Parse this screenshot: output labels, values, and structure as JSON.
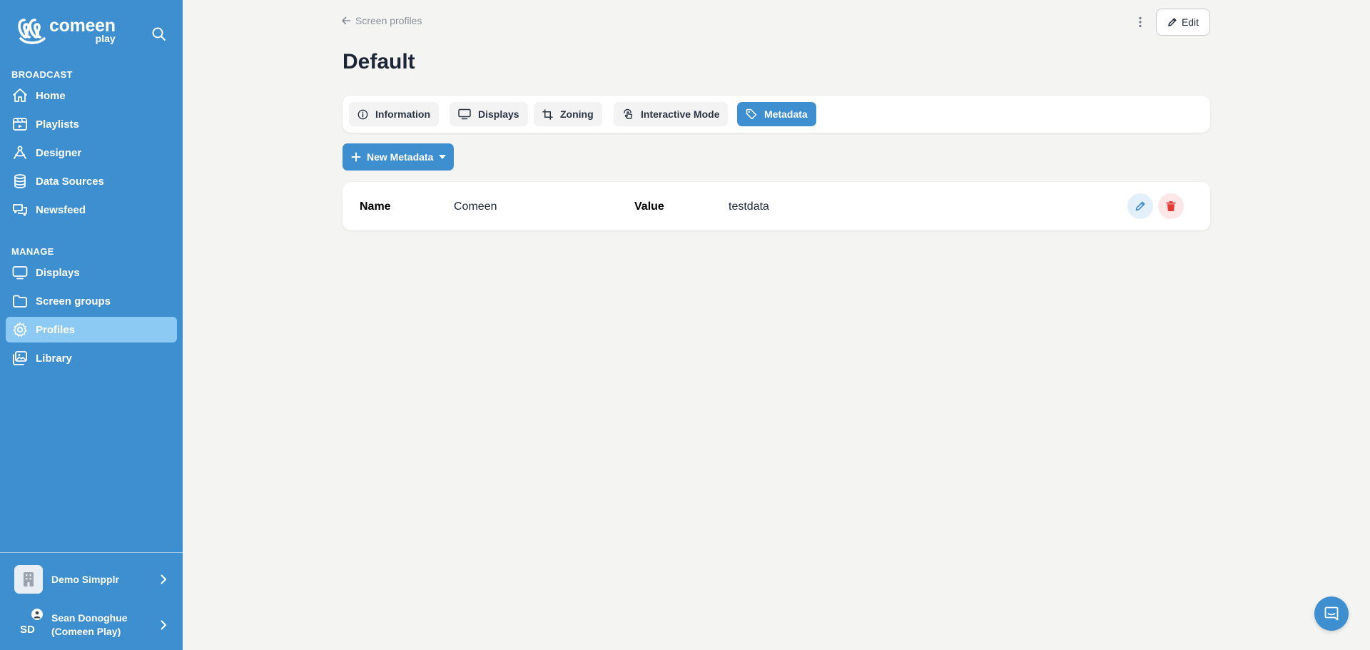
{
  "brand": {
    "name": "comeen",
    "product": "play"
  },
  "sidebar": {
    "broadcast_label": "BROADCAST",
    "manage_label": "MANAGE",
    "broadcast_items": [
      {
        "label": "Home",
        "icon": "home-icon"
      },
      {
        "label": "Playlists",
        "icon": "playlists-icon"
      },
      {
        "label": "Designer",
        "icon": "designer-icon"
      },
      {
        "label": "Data Sources",
        "icon": "database-icon"
      },
      {
        "label": "Newsfeed",
        "icon": "newsfeed-icon"
      }
    ],
    "manage_items": [
      {
        "label": "Displays",
        "icon": "monitor-icon"
      },
      {
        "label": "Screen groups",
        "icon": "folder-icon"
      },
      {
        "label": "Profiles",
        "icon": "gear-icon",
        "active": true
      },
      {
        "label": "Library",
        "icon": "library-icon"
      }
    ],
    "organization": "Demo Simpplr",
    "user": {
      "initials": "SD",
      "name_line1": "Sean Donoghue",
      "name_line2": "(Comeen Play)"
    }
  },
  "header": {
    "breadcrumb": "Screen profiles",
    "edit_label": "Edit",
    "title": "Default"
  },
  "tabs": [
    {
      "label": "Information",
      "icon": "info-icon"
    },
    {
      "label": "Displays",
      "icon": "monitor-icon"
    },
    {
      "label": "Zoning",
      "icon": "crop-icon"
    },
    {
      "label": "Interactive Mode",
      "icon": "touch-icon"
    },
    {
      "label": "Metadata",
      "icon": "tag-icon",
      "active": true
    }
  ],
  "actions": {
    "new_metadata_label": "New Metadata"
  },
  "metadata": [
    {
      "name_label": "Name",
      "name": "Comeen",
      "value_label": "Value",
      "value": "testdata"
    }
  ],
  "colors": {
    "sidebar": "#3d8fcf",
    "active_nav": "#8cc9f3",
    "primary": "#3d8fcf",
    "danger": "#e53935",
    "background": "#f4f4f3"
  }
}
